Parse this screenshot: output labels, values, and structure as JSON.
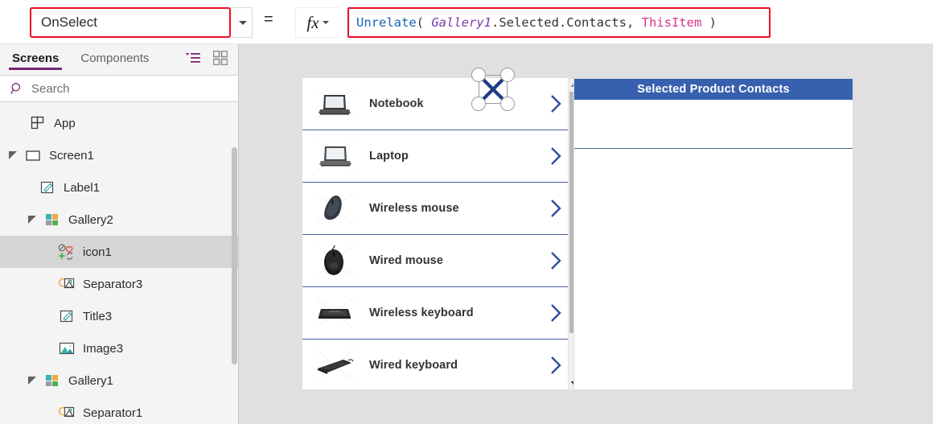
{
  "formula_bar": {
    "property_value": "OnSelect",
    "equals": "=",
    "fx_label": "fx",
    "formula_tokens": [
      {
        "text": "Unrelate",
        "type": "fn"
      },
      {
        "text": "( ",
        "type": "paren"
      },
      {
        "text": "Gallery1",
        "type": "ctl"
      },
      {
        "text": ".Selected.Contacts, ",
        "type": "plain"
      },
      {
        "text": "ThisItem",
        "type": "kw"
      },
      {
        "text": " )",
        "type": "paren"
      }
    ],
    "formula_plain": "Unrelate( Gallery1.Selected.Contacts, ThisItem )",
    "highlight_color": "#e81123"
  },
  "left_panel": {
    "tabs": [
      {
        "label": "Screens",
        "active": true
      },
      {
        "label": "Components",
        "active": false
      }
    ],
    "view_icons": [
      {
        "name": "tree-view-icon",
        "color": "#742774"
      },
      {
        "name": "tile-view-icon",
        "color": "#898989"
      }
    ],
    "search": {
      "placeholder": "Search",
      "value": "",
      "icon": "search-icon"
    },
    "tree": [
      {
        "label": "App",
        "indent": 0,
        "icon": "app-icon",
        "expander": "none",
        "selected": false
      },
      {
        "label": "Screen1",
        "indent": 0,
        "icon": "screen-icon",
        "expander": "expanded",
        "selected": false
      },
      {
        "label": "Label1",
        "indent": 1,
        "icon": "label-icon",
        "expander": "none",
        "selected": false
      },
      {
        "label": "Gallery2",
        "indent": 1,
        "icon": "gallery-icon",
        "expander": "expanded",
        "selected": false
      },
      {
        "label": "icon1",
        "indent": 2,
        "icon": "icon-icon",
        "expander": "none",
        "selected": true
      },
      {
        "label": "Separator3",
        "indent": 2,
        "icon": "shape-icon",
        "expander": "none",
        "selected": false
      },
      {
        "label": "Title3",
        "indent": 2,
        "icon": "label-icon",
        "expander": "none",
        "selected": false
      },
      {
        "label": "Image3",
        "indent": 2,
        "icon": "image-icon",
        "expander": "none",
        "selected": false
      },
      {
        "label": "Gallery1",
        "indent": 1,
        "icon": "gallery-icon",
        "expander": "expanded",
        "selected": false
      },
      {
        "label": "Separator1",
        "indent": 2,
        "icon": "shape-icon",
        "expander": "none",
        "selected": false
      }
    ]
  },
  "canvas": {
    "gallery1": {
      "items": [
        {
          "title": "Notebook",
          "thumb": "notebook-photo"
        },
        {
          "title": "Laptop",
          "thumb": "laptop-photo"
        },
        {
          "title": "Wireless mouse",
          "thumb": "wireless-mouse-photo"
        },
        {
          "title": "Wired mouse",
          "thumb": "wired-mouse-photo"
        },
        {
          "title": "Wireless keyboard",
          "thumb": "wireless-keyboard-photo"
        },
        {
          "title": "Wired keyboard",
          "thumb": "wired-keyboard-photo"
        }
      ],
      "chevron_color": "#2d4d9e",
      "separator_color": "#46609c"
    },
    "contacts_panel": {
      "header": "Selected Product Contacts",
      "header_bg": "#3760ae",
      "header_text_color": "#ffffff",
      "rows": []
    }
  }
}
